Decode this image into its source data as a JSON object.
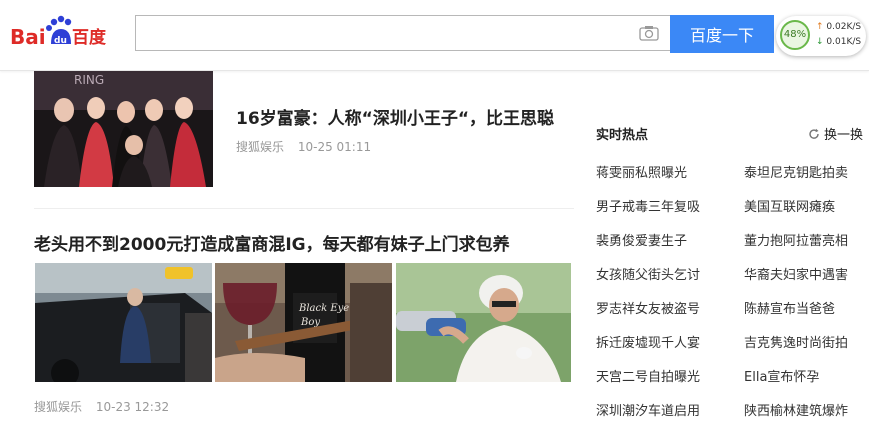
{
  "header": {
    "logo_text": "Baidu百度",
    "search_value": "",
    "search_button": "百度一下",
    "net_speed": {
      "percent": "48%",
      "upload": "0.02K/S",
      "download": "0.01K/S"
    }
  },
  "feed": {
    "item1": {
      "title": "16岁富豪：人称“深圳小王子“，比王思聪",
      "source": "搜狐娱乐",
      "time": "10-25 01:11"
    },
    "item2": {
      "title": "老头用不到2000元打造成富商混IG，每天都有妹子上门求包养",
      "source": "搜狐娱乐",
      "time": "10-23 12:32"
    }
  },
  "hot": {
    "title": "实时热点",
    "refresh": "换一换",
    "left": [
      "蒋雯丽私照曝光",
      "男子戒毒三年复吸",
      "裴勇俊爱妻生子",
      "女孩随父街头乞讨",
      "罗志祥女友被盗号",
      "拆迁废墟现千人宴",
      "天宫二号自拍曝光",
      "深圳潮汐车道启用"
    ],
    "right": [
      "泰坦尼克钥匙拍卖",
      "美国互联网瘫痪",
      "董力抱阿拉蕾亮相",
      "华裔夫妇家中遇害",
      "陈赫宣布当爸爸",
      "吉克隽逸时尚街拍",
      "Ella宣布怀孕",
      "陕西榆林建筑爆炸"
    ]
  }
}
